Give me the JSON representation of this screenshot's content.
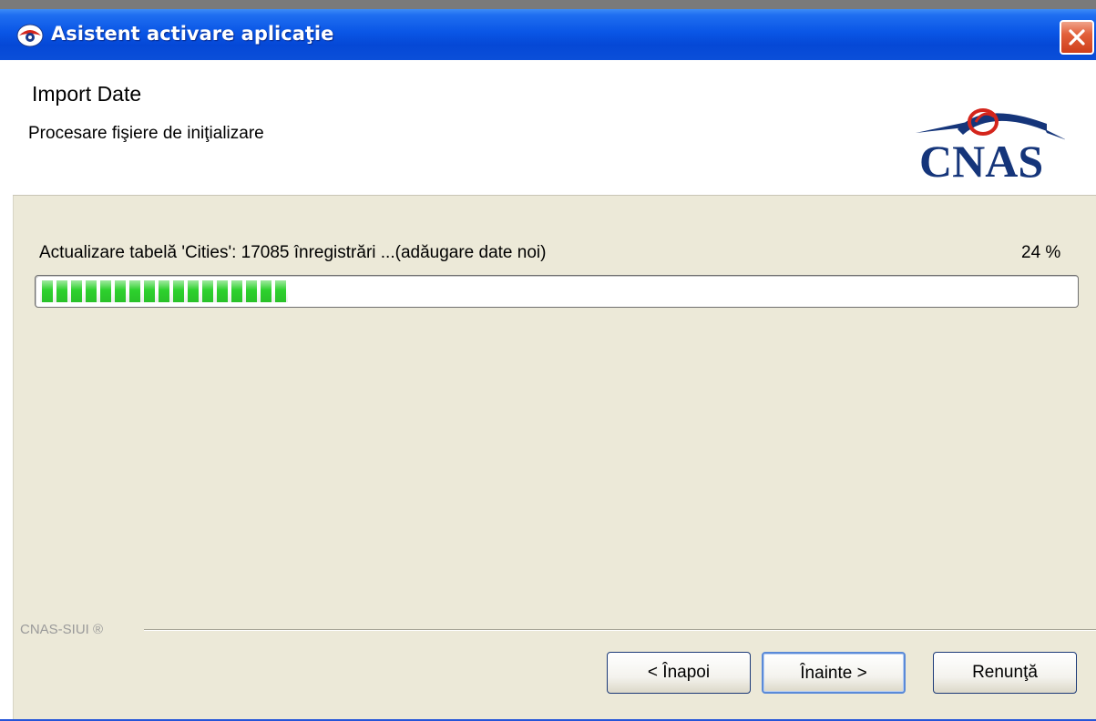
{
  "window": {
    "title": "Asistent activare aplicaţie"
  },
  "header": {
    "title": "Import Date",
    "subtitle": "Procesare fişiere de iniţializare",
    "logo_text": "CNAS"
  },
  "progress": {
    "status": "Actualizare tabelă 'Cities': 17085 înregistrări ...(adăugare date noi)",
    "percent_label": "24 %",
    "percent_value": 24,
    "fill_color": "#2dd12d"
  },
  "footer": {
    "label": "CNAS-SIUI ®"
  },
  "buttons": {
    "back": "< Înapoi",
    "next": "Înainte >",
    "cancel": "Renunţă"
  },
  "colors": {
    "titlebar": "#0a56e6",
    "logo_blue": "#15357a",
    "logo_red": "#d4251c",
    "window_bg": "#ece9d8"
  }
}
